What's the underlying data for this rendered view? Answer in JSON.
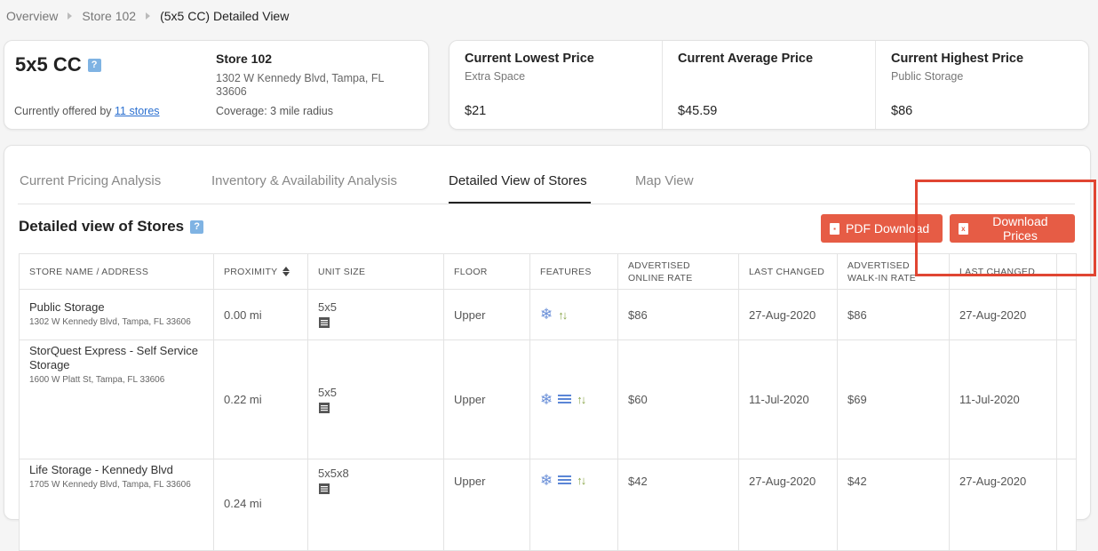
{
  "breadcrumb": {
    "items": [
      "Overview",
      "Store 102"
    ],
    "current": "(5x5 CC) Detailed View"
  },
  "unit": {
    "title": "5x5 CC",
    "help": "?",
    "offered_prefix": "Currently offered by",
    "offered_link": "11 stores",
    "store_name": "Store 102",
    "store_address": "1302 W Kennedy Blvd, Tampa, FL 33606",
    "coverage": "Coverage: 3 mile radius"
  },
  "prices": [
    {
      "title": "Current Lowest Price",
      "sub": "Extra Space",
      "value": "$21"
    },
    {
      "title": "Current Average Price",
      "sub": "",
      "value": "$45.59"
    },
    {
      "title": "Current Highest Price",
      "sub": "Public Storage",
      "value": "$86"
    }
  ],
  "tabs": [
    "Current Pricing Analysis",
    "Inventory & Availability Analysis",
    "Detailed View of Stores",
    "Map View"
  ],
  "active_tab": "Detailed View of Stores",
  "section": {
    "title": "Detailed view of Stores",
    "help": "?"
  },
  "buttons": {
    "pdf": "PDF Download",
    "prices": "Download Prices"
  },
  "table": {
    "headers": [
      "STORE NAME / ADDRESS",
      "PROXIMITY",
      "UNIT SIZE",
      "FLOOR",
      "FEATURES",
      "ADVERTISED ONLINE RATE",
      "LAST CHANGED",
      "ADVERTISED WALK-IN RATE",
      "LAST CHANGED",
      ""
    ],
    "rows": [
      {
        "name": "Public Storage",
        "address": "1302 W Kennedy Blvd, Tampa, FL 33606",
        "proximity": "0.00 mi",
        "unit_size": "5x5",
        "floor": "Upper",
        "features": [
          "climate-control",
          "elevator"
        ],
        "online_rate": "$86",
        "online_changed": "27-Aug-2020",
        "walkin_rate": "$86",
        "walkin_changed": "27-Aug-2020"
      },
      {
        "name": "StorQuest Express - Self Service Storage",
        "address": "1600 W Platt St, Tampa, FL 33606",
        "proximity": "0.22 mi",
        "unit_size": "5x5",
        "floor": "Upper",
        "features": [
          "climate-control",
          "indoor",
          "elevator"
        ],
        "online_rate": "$60",
        "online_changed": "11-Jul-2020",
        "walkin_rate": "$69",
        "walkin_changed": "11-Jul-2020"
      },
      {
        "name": "Life Storage - Kennedy Blvd",
        "address": "1705 W Kennedy Blvd, Tampa, FL 33606",
        "proximity": "0.24 mi",
        "unit_size": "5x5x8",
        "floor": "Upper",
        "features": [
          "climate-control",
          "indoor",
          "elevator"
        ],
        "online_rate": "$42",
        "online_changed": "27-Aug-2020",
        "walkin_rate": "$42",
        "walkin_changed": "27-Aug-2020"
      }
    ]
  },
  "colors": {
    "accent": "#e65c45",
    "link": "#2a6fd0",
    "highlight": "#e04532"
  }
}
